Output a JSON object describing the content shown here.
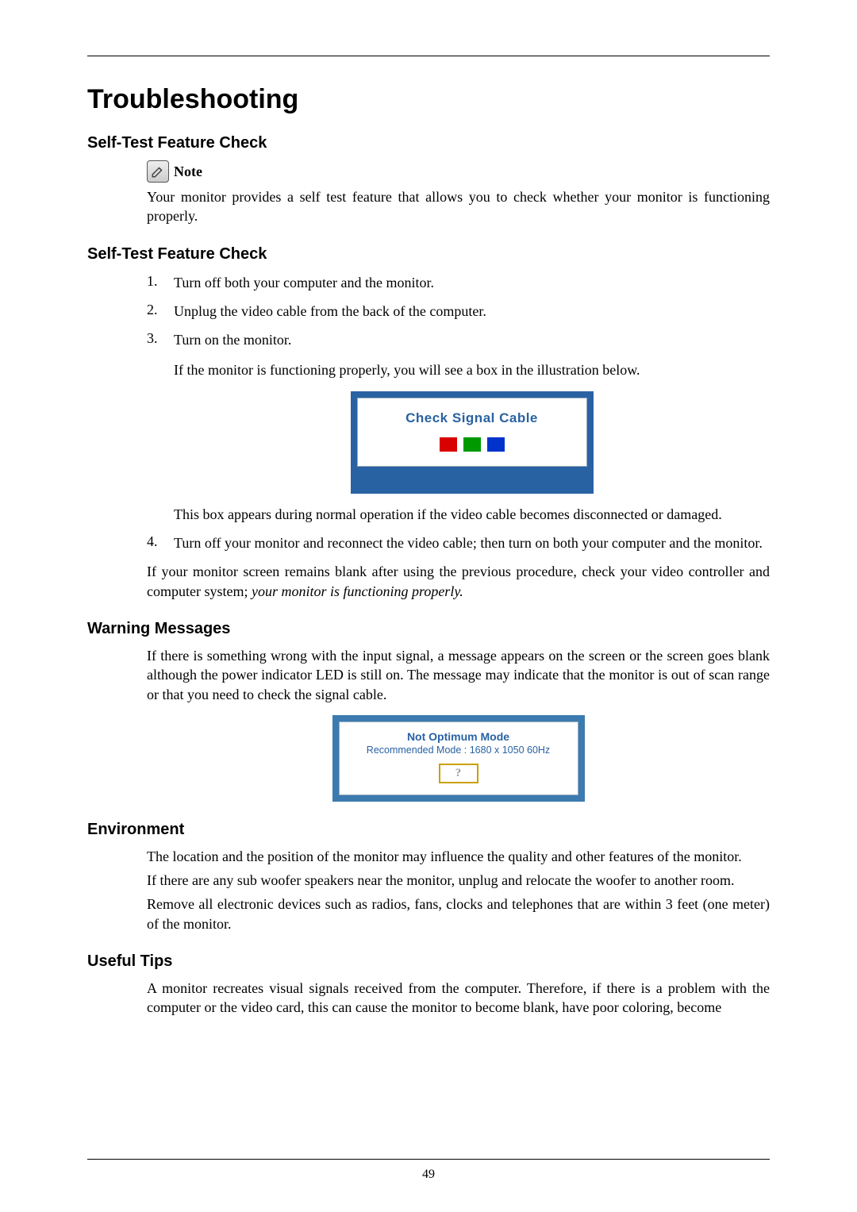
{
  "pageNumber": "49",
  "title": "Troubleshooting",
  "sections": {
    "selfTest1": {
      "heading": "Self-Test Feature Check",
      "noteLabel": "Note",
      "noteText": "Your monitor provides a self test feature that allows you to check whether your monitor is functioning properly."
    },
    "selfTest2": {
      "heading": "Self-Test Feature Check",
      "steps": [
        "Turn off both your computer and the monitor.",
        "Unplug the video cable from the back of the computer.",
        "Turn on the monitor."
      ],
      "step3Follow": "If the monitor is functioning properly, you will see a box in the illustration below.",
      "fig1": "Check Signal Cable",
      "afterFig": "This box appears during normal operation if the video cable becomes disconnected or damaged.",
      "step4": "Turn off your monitor and reconnect the video cable; then turn on both your computer and the monitor.",
      "conclusionA": "If your monitor screen remains blank after using the previous procedure, check your video controller and computer system; ",
      "conclusionItalic": "your monitor is functioning properly."
    },
    "warning": {
      "heading": "Warning Messages",
      "text": "If there is something wrong with the input signal, a message appears on the screen or the screen goes blank although the power indicator LED is still on. The message may indicate that the monitor is out of scan range or that you need to check the signal cable.",
      "fig2line1": "Not Optimum Mode",
      "fig2line2": "Recommended Mode : 1680 x 1050 60Hz",
      "fig2q": "?"
    },
    "environment": {
      "heading": "Environment",
      "p1": "The location and the position of the monitor may influence the quality and other features of the monitor.",
      "p2": "If there are any sub woofer speakers near the monitor, unplug and relocate the woofer to another room.",
      "p3": "Remove all electronic devices such as radios, fans, clocks and telephones that are within 3 feet (one meter) of the monitor."
    },
    "tips": {
      "heading": "Useful Tips",
      "p1": "A monitor recreates visual signals received from the computer. Therefore, if there is a problem with the computer or the video card, this can cause the monitor to become blank, have poor coloring, become"
    }
  }
}
